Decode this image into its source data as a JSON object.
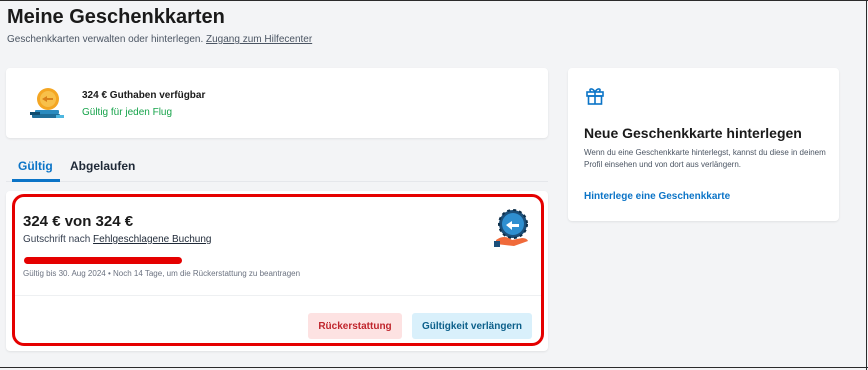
{
  "header": {
    "title": "Meine Geschenkkarten",
    "subtitle": "Geschenkkarten verwalten oder hinterlegen.",
    "help_link": "Zugang zum Hilfecenter"
  },
  "balance": {
    "amount_text": "324 € Guthaben verfügbar",
    "note": "Gültig für jeden Flug",
    "illustration": "coin-stack-icon"
  },
  "tabs": [
    {
      "label": "Gültig",
      "active": true
    },
    {
      "label": "Abgelaufen",
      "active": false
    }
  ],
  "voucher": {
    "title": "324 € von 324 €",
    "desc_prefix": "Gutschrift nach",
    "desc_link": "Fehlgeschlagene Buchung",
    "validity": "Gültig bis 30. Aug 2024 • Noch 14 Tage, um die Rückerstattung zu beantragen",
    "refund_label": "Rückerstattung",
    "extend_label": "Gültigkeit verlängern",
    "illustration": "hand-with-coin-icon"
  },
  "side": {
    "icon": "gift-icon",
    "title": "Neue Geschenkkarte hinterlegen",
    "text": "Wenn du eine Geschenkkarte hinterlegst, kannst du diese in deinem Profil einsehen und von dort aus verlängern.",
    "link": "Hinterlege eine Geschenkkarte"
  },
  "colors": {
    "accent": "#0b74c7",
    "success": "#16a34a",
    "highlight": "#e50000",
    "refund_bg": "#fde2e2",
    "extend_bg": "#d9f0fb"
  }
}
